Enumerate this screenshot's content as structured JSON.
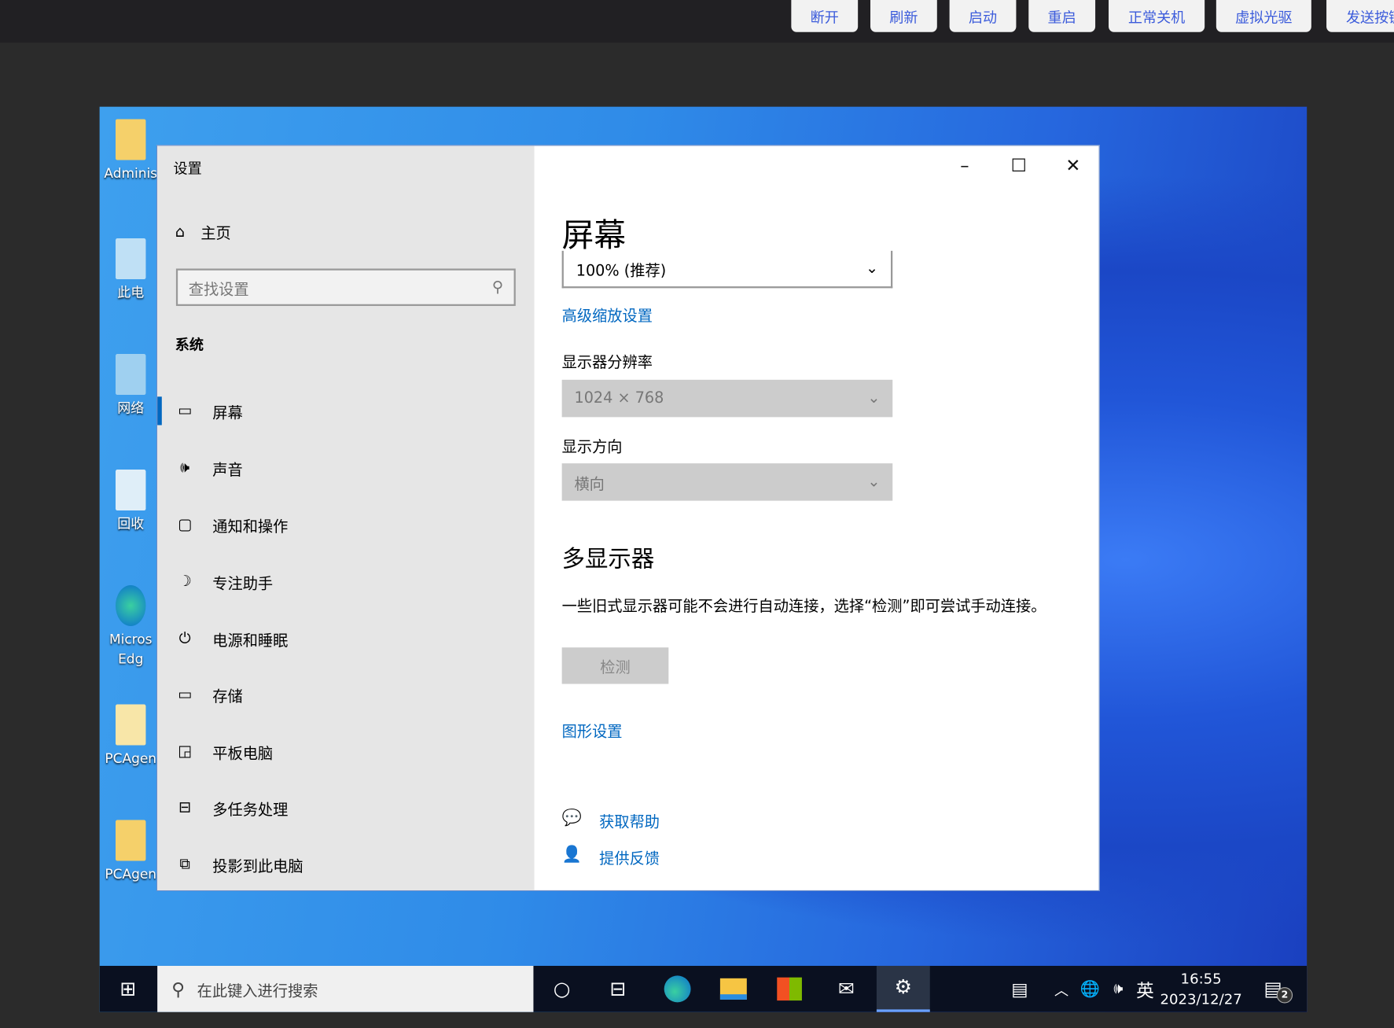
{
  "toolbar": {
    "buttons": [
      "断开",
      "刷新",
      "启动",
      "重启",
      "正常关机",
      "虚拟光驱",
      "发送按键"
    ]
  },
  "desktop": {
    "icons": [
      {
        "label": "Adminis"
      },
      {
        "label": "此电"
      },
      {
        "label": "网络"
      },
      {
        "label": "回收"
      },
      {
        "label": "Micros",
        "label2": "Edg"
      },
      {
        "label": "PCAgen"
      },
      {
        "label": "PCAgen"
      }
    ]
  },
  "settings": {
    "title": "设置",
    "home": "主页",
    "search_placeholder": "查找设置",
    "section": "系统",
    "nav": [
      {
        "label": "屏幕",
        "icon": "monitor-icon"
      },
      {
        "label": "声音",
        "icon": "speaker-icon"
      },
      {
        "label": "通知和操作",
        "icon": "notification-icon"
      },
      {
        "label": "专注助手",
        "icon": "moon-icon"
      },
      {
        "label": "电源和睡眠",
        "icon": "power-icon"
      },
      {
        "label": "存储",
        "icon": "storage-icon"
      },
      {
        "label": "平板电脑",
        "icon": "tablet-icon"
      },
      {
        "label": "多任务处理",
        "icon": "multitask-icon"
      },
      {
        "label": "投影到此电脑",
        "icon": "project-icon"
      }
    ],
    "page_title": "屏幕",
    "scale_value": "100% (推荐)",
    "advanced_scaling": "高级缩放设置",
    "resolution_label": "显示器分辨率",
    "resolution_value": "1024 × 768",
    "orientation_label": "显示方向",
    "orientation_value": "横向",
    "multi_title": "多显示器",
    "multi_desc": "一些旧式显示器可能不会进行自动连接，选择“检测”即可尝试手动连接。",
    "detect": "检测",
    "graphics": "图形设置",
    "help": "获取帮助",
    "feedback": "提供反馈"
  },
  "taskbar": {
    "search_placeholder": "在此键入进行搜索",
    "ime": "英",
    "time": "16:55",
    "date": "2023/12/27",
    "notifications": "2"
  }
}
